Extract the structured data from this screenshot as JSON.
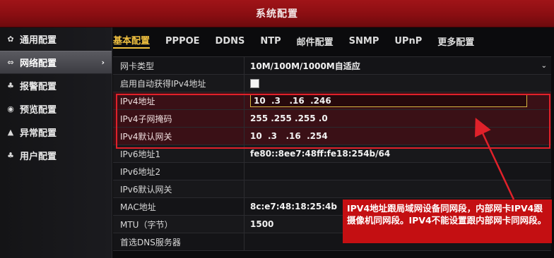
{
  "window": {
    "title": "系统配置"
  },
  "sidebar": {
    "items": [
      {
        "icon": "gear-icon",
        "glyph": "✿",
        "label": "通用配置",
        "active": false
      },
      {
        "icon": "network-icon",
        "glyph": "⇔",
        "label": "网络配置",
        "active": true,
        "chevron": "›"
      },
      {
        "icon": "alarm-icon",
        "glyph": "♣",
        "label": "报警配置",
        "active": false
      },
      {
        "icon": "preview-icon",
        "glyph": "◉",
        "label": "预览配置",
        "active": false
      },
      {
        "icon": "warning-icon",
        "glyph": "▲",
        "label": "异常配置",
        "active": false
      },
      {
        "icon": "user-icon",
        "glyph": "♣",
        "label": "用户配置",
        "active": false
      }
    ]
  },
  "tabs": [
    "基本配置",
    "PPPOE",
    "DDNS",
    "NTP",
    "邮件配置",
    "SNMP",
    "UPnP",
    "更多配置"
  ],
  "active_tab": "基本配置",
  "fields": [
    {
      "label": "网卡类型",
      "value": "10M/100M/1000M自适应"
    },
    {
      "label": "启用自动获得IPv4地址",
      "value": ""
    },
    {
      "label": "IPv4地址",
      "value": "10  .3   .16  .246"
    },
    {
      "label": "IPv4子网掩码",
      "value": "255 .255 .255 .0"
    },
    {
      "label": "IPv4默认网关",
      "value": "10  .3   .16  .254"
    },
    {
      "label": "IPv6地址1",
      "value": "fe80::8ee7:48ff:fe18:254b/64"
    },
    {
      "label": "IPv6地址2",
      "value": ""
    },
    {
      "label": "IPv6默认网关",
      "value": ""
    },
    {
      "label": "MAC地址",
      "value": "8c:e7:48:18:25:4b"
    },
    {
      "label": "MTU（字节）",
      "value": "1500"
    },
    {
      "label": "首选DNS服务器",
      "value": ""
    }
  ],
  "annotation": {
    "text": "IPV4地址跟局域网设备同网段，内部网卡IPV4跟摄像机同网段。IPV4不能设置跟内部网卡同网段。",
    "color": "#c40f12"
  },
  "colors": {
    "accent": "#f0c040",
    "titlebar": "#8a0e12",
    "highlight": "#e0212a"
  }
}
